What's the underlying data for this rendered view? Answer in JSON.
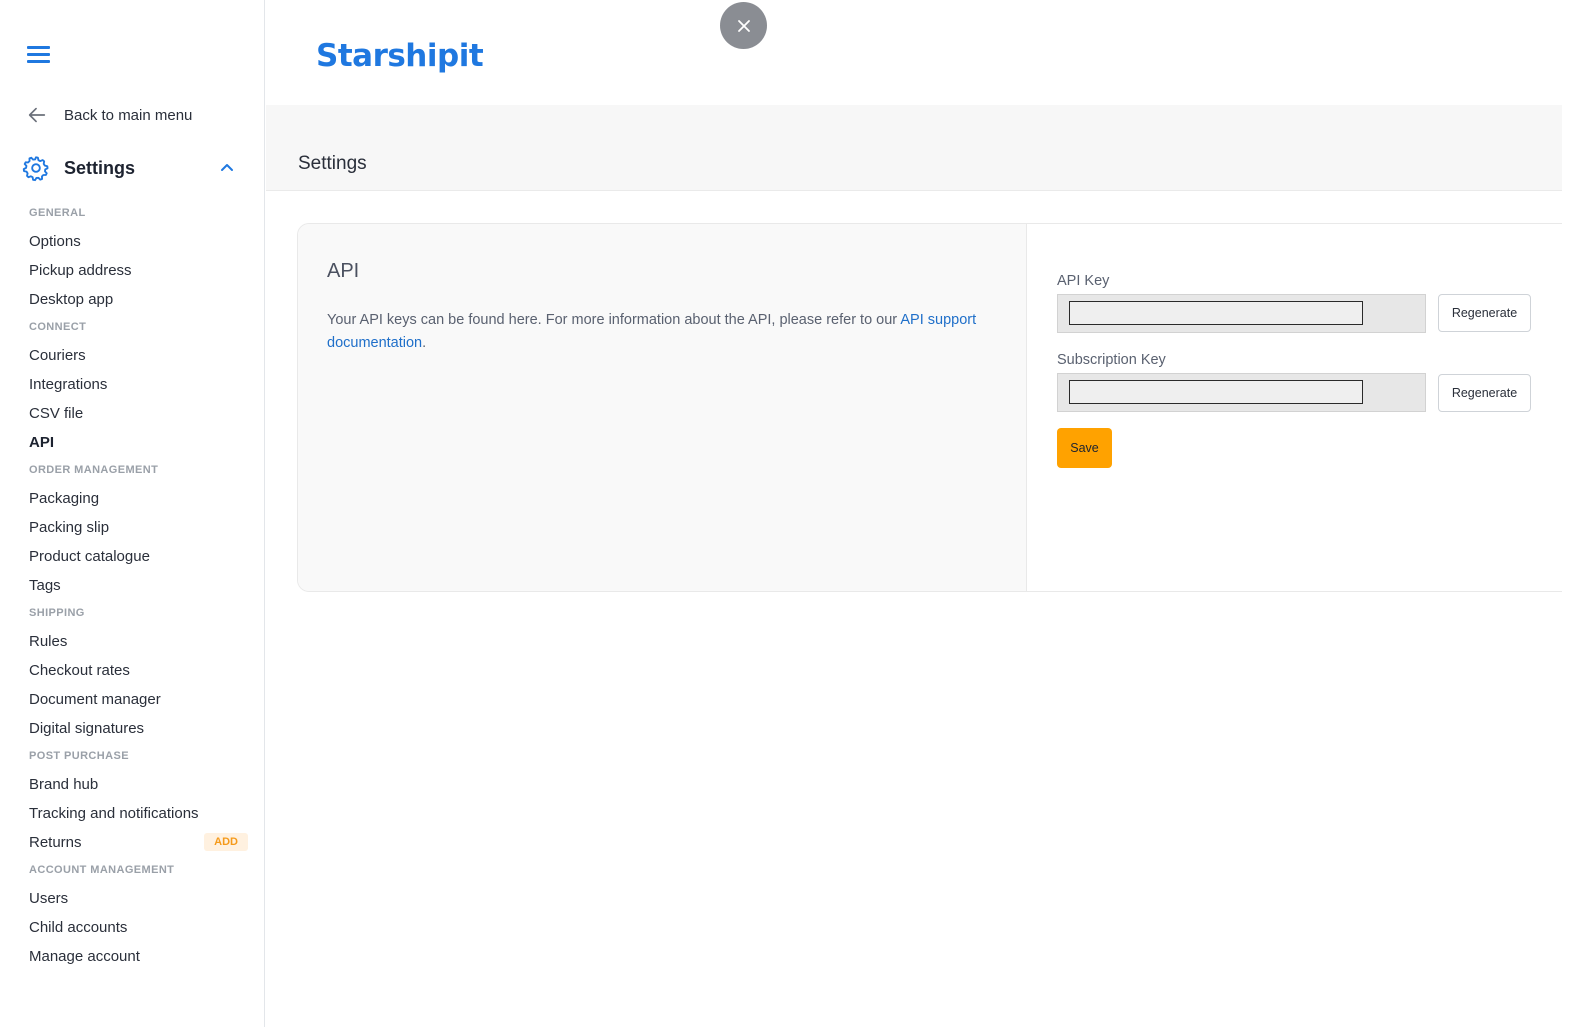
{
  "app": {
    "logo_text": "Starshipit"
  },
  "sidebar": {
    "back_label": "Back to main menu",
    "settings_label": "Settings",
    "sections": [
      {
        "heading": "GENERAL",
        "items": [
          {
            "label": "Options"
          },
          {
            "label": "Pickup address"
          },
          {
            "label": "Desktop app"
          }
        ]
      },
      {
        "heading": "CONNECT",
        "items": [
          {
            "label": "Couriers"
          },
          {
            "label": "Integrations"
          },
          {
            "label": "CSV file"
          },
          {
            "label": "API",
            "active": true
          }
        ]
      },
      {
        "heading": "ORDER MANAGEMENT",
        "items": [
          {
            "label": "Packaging"
          },
          {
            "label": "Packing slip"
          },
          {
            "label": "Product catalogue"
          },
          {
            "label": "Tags"
          }
        ]
      },
      {
        "heading": "SHIPPING",
        "items": [
          {
            "label": "Rules"
          },
          {
            "label": "Checkout rates"
          },
          {
            "label": "Document manager"
          },
          {
            "label": "Digital signatures"
          }
        ]
      },
      {
        "heading": "POST PURCHASE",
        "items": [
          {
            "label": "Brand hub"
          },
          {
            "label": "Tracking and notifications"
          },
          {
            "label": "Returns",
            "badge": "ADD"
          }
        ]
      },
      {
        "heading": "ACCOUNT MANAGEMENT",
        "items": [
          {
            "label": "Users"
          },
          {
            "label": "Child accounts"
          },
          {
            "label": "Manage account"
          }
        ]
      }
    ]
  },
  "page": {
    "title": "Settings"
  },
  "api_card": {
    "title": "API",
    "description": "Your API keys can be found here. For more information about the API, please refer to our ",
    "link_text": "API support documentation",
    "description_end": ".",
    "api_key_label": "API Key",
    "api_key_value": "",
    "subscription_key_label": "Subscription Key",
    "subscription_key_value": "",
    "regenerate_label": "Regenerate",
    "save_label": "Save"
  },
  "colors": {
    "brand": "#1f78e0",
    "save": "#ffa200",
    "badge_text": "#f59a1b"
  }
}
